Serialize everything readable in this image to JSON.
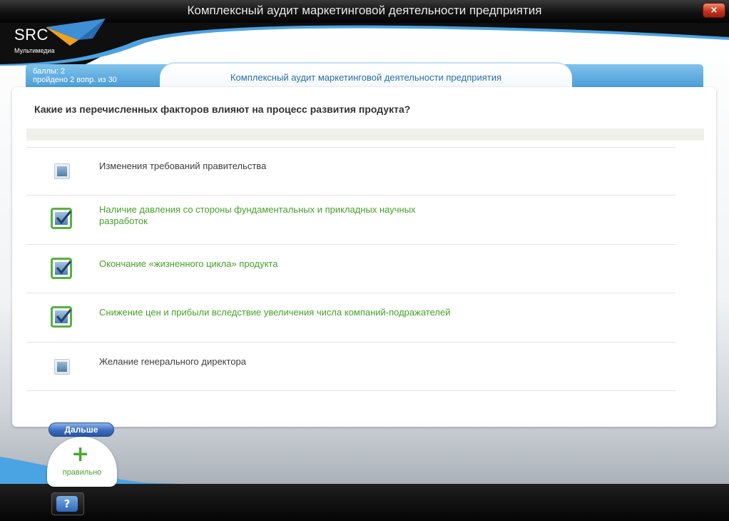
{
  "window": {
    "title": "Комплексный аудит маркетинговой деятельности предприятия",
    "close_glyph": "×"
  },
  "logo": {
    "name": "SRC",
    "subtitle": "Мультимедиа"
  },
  "status": {
    "score_label": "баллы: 2",
    "progress_label": "пройдено  2  вопр. из  30"
  },
  "course_tab": {
    "label": "Комплексный аудит маркетинговой деятельности предприятия"
  },
  "question": {
    "text": "Какие из перечисленных факторов влияют на процесс развития продукта?"
  },
  "answers": [
    {
      "line1": "Изменения требований правительства",
      "line2": "",
      "checked": false
    },
    {
      "line1": "Наличие давления со стороны фундаментальных и прикладных научных",
      "line2": "разработок",
      "checked": true
    },
    {
      "line1": "Окончание «жизненного цикла» продукта",
      "line2": "",
      "checked": true
    },
    {
      "line1": "Снижение цен и прибыли вследствие увеличения числа компаний-подражателей",
      "line2": "",
      "checked": true
    },
    {
      "line1": "Желание генерального директора",
      "line2": "",
      "checked": false
    }
  ],
  "buttons": {
    "next_label": "Дальше",
    "help_glyph": "?"
  },
  "result": {
    "symbol": "+",
    "label": "правильно"
  },
  "colors": {
    "accent_blue": "#3f95d3",
    "correct_green": "#46a02a",
    "selected_border": "#57b23d"
  }
}
